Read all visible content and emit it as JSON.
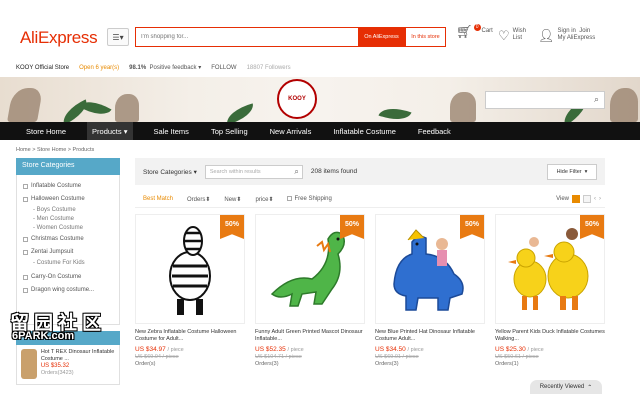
{
  "header": {
    "logo": "AliExpress",
    "search_placeholder": "I'm shopping for...",
    "search_all_label": "On AliExpress",
    "search_store_label": "In this store",
    "cart_label": "Cart",
    "cart_count": "0",
    "wishlist_label": "Wish List",
    "signin_label": "Sign in",
    "join_label": "Join",
    "myaliexpress_label": "My AliExpress"
  },
  "store": {
    "name": "KOOY Official Store",
    "open": "Open 6 year(s)",
    "feedback_pct": "98.1%",
    "feedback_label": "Positive feedback",
    "follow_label": "FOLLOW",
    "followers": "18807 Followers",
    "logo_text": "KOOY"
  },
  "nav": [
    "Store Home",
    "Products",
    "Sale Items",
    "Top Selling",
    "New Arrivals",
    "Inflatable Costume",
    "Feedback"
  ],
  "breadcrumb": "Home > Store Home > Products",
  "sidebar": {
    "title": "Store Categories",
    "items": [
      {
        "label": "Inflatable Costume",
        "subs": []
      },
      {
        "label": "Halloween Costume",
        "subs": [
          "Boys Costume",
          "Men Costume",
          "Women Costume"
        ]
      },
      {
        "label": "Christmas Costume",
        "subs": []
      },
      {
        "label": "Zentai Jumpsuit",
        "subs": [
          "Costume For Kids"
        ]
      },
      {
        "label": "Carry-On Costume",
        "subs": []
      },
      {
        "label": "Dragon wing costume...",
        "subs": []
      }
    ],
    "recommend_title": "Recommend",
    "recommend_item": {
      "name": "Hot T REX Dinosaur Inflatable Costume ...",
      "price": "US $35.32",
      "orders": "Orders(3423)"
    }
  },
  "toolbar": {
    "categories_label": "Store Categories",
    "within_placeholder": "Search within results",
    "count": "208 items found",
    "hide_filter": "Hide Filter"
  },
  "sort": {
    "best_match": "Best Match",
    "orders": "Orders",
    "new": "New",
    "price": "price",
    "free_shipping": "Free Shipping",
    "view_label": "View"
  },
  "products": [
    {
      "name": "New Zebra Inflatable Costume Halloween Costume for Adult...",
      "price": "US $34.97",
      "unit": "/ piece",
      "old": "US $69.94 / piece",
      "orders": "Order(s)",
      "badge": "50%"
    },
    {
      "name": "Funny Adult Green Printed Mascot Dinosaur Inflatable...",
      "price": "US $52.35",
      "unit": "/ piece",
      "old": "US $104.71 / piece",
      "orders": "Orders(3)",
      "badge": "50%"
    },
    {
      "name": "New Blue Printed Hat Dinosaur Inflatable Costume Adult...",
      "price": "US $34.50",
      "unit": "/ piece",
      "old": "US $69.01 / piece",
      "orders": "Orders(3)",
      "badge": "50%"
    },
    {
      "name": "Yellow Parent Kids Duck Inflatable Costumes Walking...",
      "price": "US $25.30",
      "unit": "/ piece",
      "old": "US $50.61 / piece",
      "orders": "Orders(1)",
      "badge": "50%"
    }
  ],
  "recently_viewed": "Recently Viewed",
  "watermark": {
    "line1": "留园社区",
    "line2": "6PARK.com"
  },
  "colors": {
    "brand": "#e62e04",
    "accent": "#e88a00",
    "sidebar_blue": "#56a8c8",
    "nav_bg": "#111111"
  }
}
